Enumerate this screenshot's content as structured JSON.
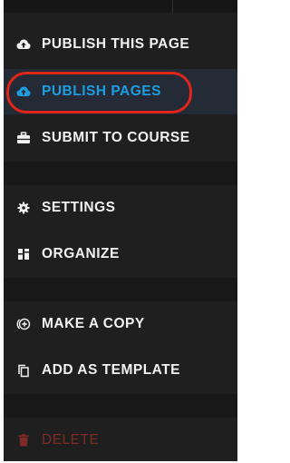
{
  "menu": {
    "items": [
      {
        "label": "PUBLISH THIS PAGE",
        "icon": "cloud-upload-icon"
      },
      {
        "label": "PUBLISH PAGES",
        "icon": "cloud-upload-icon",
        "active": true
      },
      {
        "label": "SUBMIT TO COURSE",
        "icon": "briefcase-icon"
      },
      {
        "label": "SETTINGS",
        "icon": "gear-icon"
      },
      {
        "label": "ORGANIZE",
        "icon": "grid-icon"
      },
      {
        "label": "MAKE A COPY",
        "icon": "copy-circle-icon"
      },
      {
        "label": "ADD AS TEMPLATE",
        "icon": "template-icon"
      },
      {
        "label": "DELETE",
        "icon": "trash-icon",
        "danger": true
      }
    ]
  },
  "colors": {
    "background": "#1f1f20",
    "text": "#f2f2f2",
    "active_text": "#1d9ee0",
    "active_bg": "#252a37",
    "highlight": "#e0251b",
    "danger": "#7e2a27"
  }
}
